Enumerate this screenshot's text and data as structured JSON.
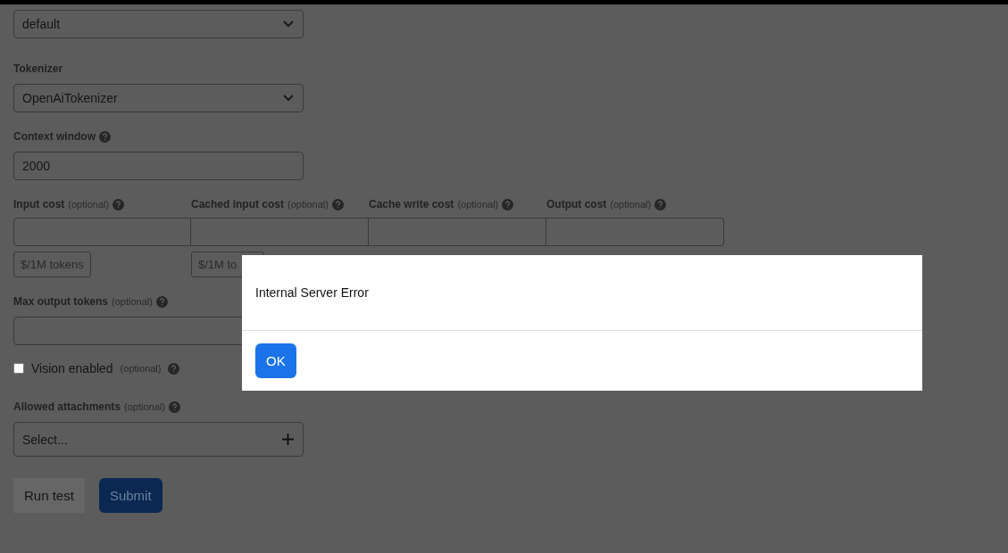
{
  "form": {
    "fields": [
      {
        "kind": "select",
        "value": "default"
      },
      {
        "kind": "select",
        "label": "Tokenizer",
        "help": false,
        "value": "OpenAiTokenizer"
      },
      {
        "kind": "text",
        "label": "Context window",
        "help": true,
        "value": "2000"
      },
      {
        "kind": "costs",
        "items": [
          {
            "label": "Input cost",
            "optional": "(optional)",
            "unit": "$/1M tokens"
          },
          {
            "label": "Cached input cost",
            "optional": "(optional)",
            "unit": "$/1M to"
          },
          {
            "label": "Cache write cost",
            "optional": "(optional)"
          },
          {
            "label": "Output cost",
            "optional": "(optional)"
          }
        ]
      },
      {
        "kind": "text",
        "label": "Max output tokens",
        "optional": "(optional)",
        "help": true
      },
      {
        "kind": "checkbox",
        "label": "Vision enabled",
        "optional": "(optional)",
        "help": true,
        "checked": false
      },
      {
        "kind": "multiselect",
        "label": "Allowed attachments",
        "optional": "(optional)",
        "help": true,
        "placeholder": "Select..."
      }
    ],
    "buttons": [
      {
        "label": "Run test",
        "kind": "secondary"
      },
      {
        "label": "Submit",
        "kind": "primary"
      }
    ]
  },
  "dialog": {
    "message": "Internal Server Error",
    "button": "OK"
  }
}
